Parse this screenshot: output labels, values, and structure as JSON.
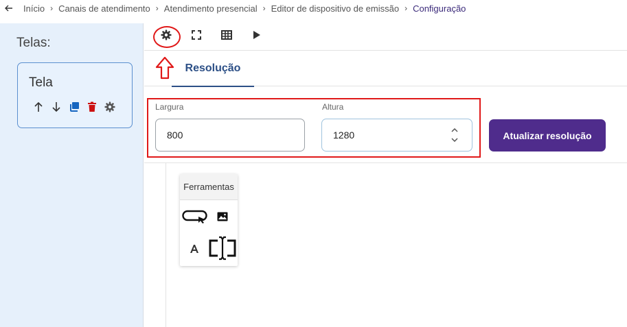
{
  "breadcrumb": {
    "items": [
      "Início",
      "Canais de atendimento",
      "Atendimento presencial",
      "Editor de dispositivo de emissão"
    ],
    "current": "Configuração",
    "separator": "›"
  },
  "sidebar": {
    "title": "Telas:",
    "screens": [
      {
        "name": "Tela",
        "actions": [
          "arrow-up-icon",
          "arrow-down-icon",
          "duplicate-icon",
          "delete-icon",
          "settings-icon"
        ]
      }
    ]
  },
  "toolbar": {
    "tools": [
      "settings-icon",
      "fullscreen-icon",
      "grid-icon",
      "play-icon"
    ]
  },
  "tabs": [
    {
      "label": "Resolução",
      "active": true
    }
  ],
  "resolution": {
    "width_label": "Largura",
    "width_value": "800",
    "height_label": "Altura",
    "height_value": "1280",
    "update_button": "Atualizar resolução"
  },
  "tools_panel": {
    "title": "Ferramentas",
    "items": [
      "button-tool-icon",
      "image-tool-icon",
      "text-tool-icon",
      "input-field-tool-icon"
    ]
  },
  "colors": {
    "accent_purple": "#4f2c8c",
    "tab_blue": "#2c4f86",
    "delete_red": "#cc1111",
    "duplicate_blue": "#1565c0",
    "annotation_red": "#e01818",
    "sidebar_bg": "#e6f0fb"
  }
}
